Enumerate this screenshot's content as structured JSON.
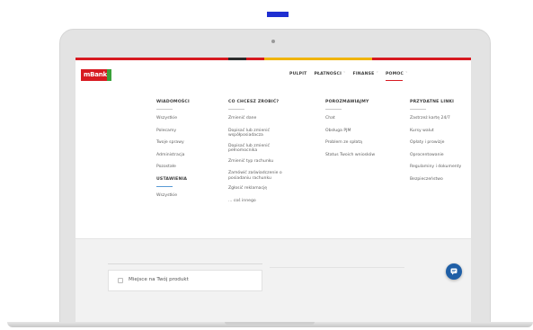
{
  "colors": {
    "brand_red": "#d71a21",
    "brand_green": "#3aa13a",
    "accent_blue": "#1f5fa6",
    "bar_segments": [
      "#d71a21",
      "#2b2b2b",
      "#d71a21",
      "#f0b400",
      "#d71a21"
    ]
  },
  "header": {
    "logo_text": "mBank",
    "nav": [
      {
        "label": "PULPIT",
        "chevron": ""
      },
      {
        "label": "PŁATNOŚCI",
        "chevron": "˅"
      },
      {
        "label": "FINANSE",
        "chevron": "˅"
      },
      {
        "label": "POMOC",
        "chevron": "˅"
      }
    ]
  },
  "menu": {
    "messages": {
      "title": "WIADOMOŚCI",
      "items": [
        "Wszystkie",
        "Polecamy",
        "Twoje sprawy",
        "Administracja",
        "Pozostałe"
      ]
    },
    "settings": {
      "title": "USTAWIENIA",
      "items": [
        "Wszystkie"
      ]
    },
    "actions": {
      "title": "CO CHCESZ ZROBIĆ?",
      "items": [
        "Zmienić dane",
        "Dopisać lub zmienić współposiadacza",
        "Dopisać lub zmienić pełnomocnika",
        "Zmienić typ rachunku",
        "Zamówić zaświadczenie o posiadaniu rachunku",
        "Zgłosić reklamację",
        "... coś innego"
      ]
    },
    "talk": {
      "title": "POROZMAWIAJMY",
      "items": [
        "Chat",
        "Obsługa PJM",
        "Problem ze spłatą",
        "Status Twoich wniosków"
      ]
    },
    "links": {
      "title": "PRZYDATNE LINKI",
      "items": [
        "Zastrzeż kartę 24/7",
        "Kursy walut",
        "Opłaty i prowizje",
        "Oprocentowanie",
        "Regulaminy i dokumenty",
        "Bezpieczeństwo"
      ]
    }
  },
  "content": {
    "product_placeholder": "Miejsce na Twój produkt"
  },
  "icons": {
    "chat": "chat-bubble-icon",
    "product": "product-placeholder-icon"
  }
}
